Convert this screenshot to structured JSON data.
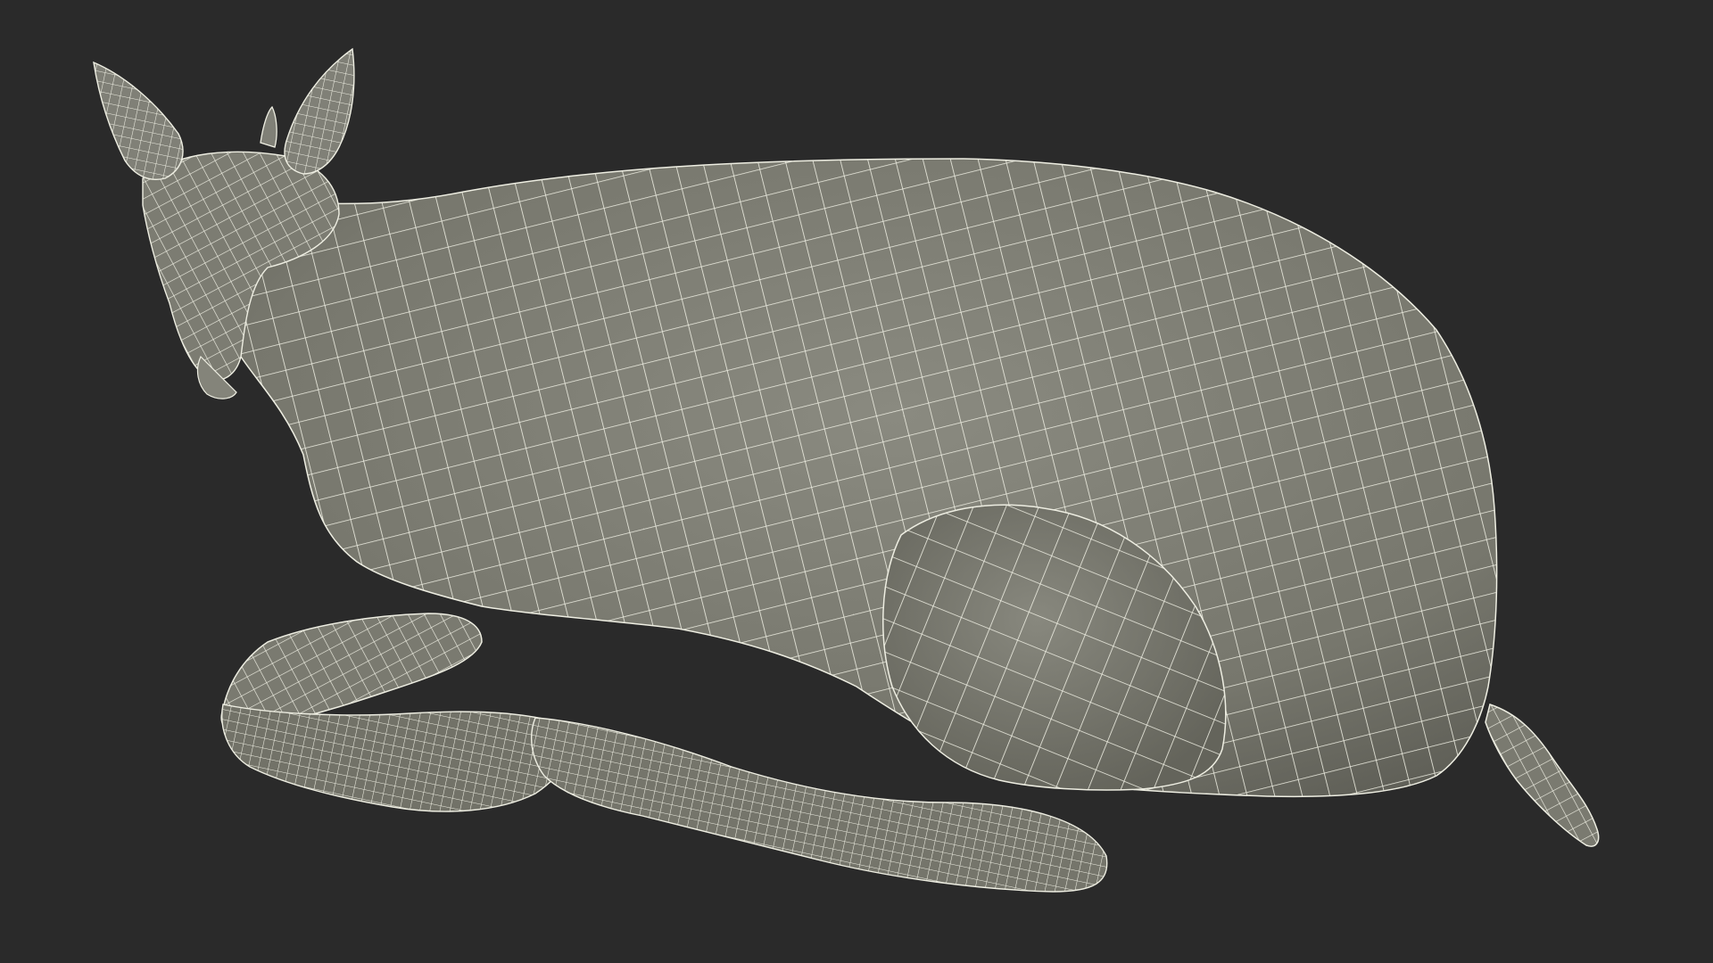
{
  "scene": {
    "subject_icon": "deer-wireframe-icon",
    "colors": {
      "background": "#2a2a2a",
      "surface": "#7a7a70",
      "surface_shadow": "#5f5f57",
      "surface_highlight": "#8a8a80",
      "wire": "#eeeee2"
    }
  }
}
